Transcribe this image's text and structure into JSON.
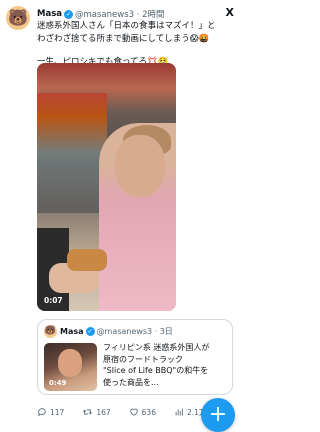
{
  "tweet": {
    "author_name": "Masa",
    "handle_time": "@masanews3 · 2時間",
    "text_lines": [
      "迷惑系外国人さん「日本の食事はマズイ！」と",
      "わざわざ捨てる所まで動画にしてしまう😱🤬",
      "",
      "一生、ピロシキでも食ってろ💢🤮"
    ],
    "video_duration": "0:07",
    "avatar_emoji": "🐻",
    "platform_logo": "X"
  },
  "quote": {
    "author_name": "Masa",
    "handle_time": "@masanews3 · 3日",
    "text_lines": [
      "フィリピン系 迷惑系外国人が",
      "原宿のフードトラック",
      "\"Slice of Life BBQ\"の和牛を",
      "使った商品を..."
    ],
    "video_duration": "0:49",
    "avatar_emoji": "🐻"
  },
  "actions": {
    "reply_count": "117",
    "retweet_count": "167",
    "like_count": "636",
    "views_count": "2.1万"
  },
  "fab": {
    "label": "+"
  },
  "colors": {
    "accent": "#1d9bf0",
    "muted": "#536471",
    "text": "#0f1419"
  }
}
